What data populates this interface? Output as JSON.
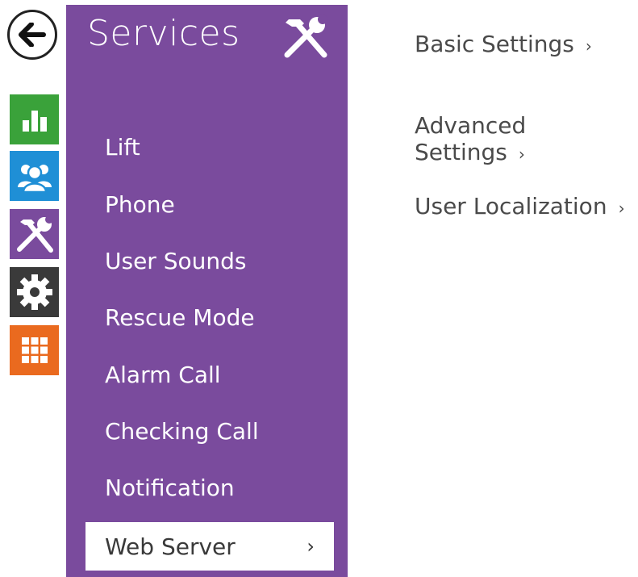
{
  "panel": {
    "title": "Services",
    "title_icon": "tools-icon",
    "color": "#7a4b9d",
    "items": [
      {
        "label": "Lift"
      },
      {
        "label": "Phone"
      },
      {
        "label": "User Sounds"
      },
      {
        "label": "Rescue Mode"
      },
      {
        "label": "Alarm Call"
      },
      {
        "label": "Checking Call"
      },
      {
        "label": "Notification"
      },
      {
        "label": "Web Server",
        "selected": true,
        "chevron": "›"
      }
    ]
  },
  "rail": [
    {
      "icon": "bar-chart-icon",
      "color": "#3aa23a"
    },
    {
      "icon": "users-icon",
      "color": "#1f8fd6"
    },
    {
      "icon": "tools-icon",
      "color": "#7a4b9d"
    },
    {
      "icon": "gear-icon",
      "color": "#3a3a3a"
    },
    {
      "icon": "grid-icon",
      "color": "#ea6a1f"
    }
  ],
  "back_icon": "arrow-left-icon",
  "sub_links": [
    {
      "label": "Basic Settings",
      "chevron": "›"
    },
    {
      "label": "Advanced Settings",
      "chevron": "›"
    },
    {
      "label": "User Localization",
      "chevron": "›"
    }
  ]
}
